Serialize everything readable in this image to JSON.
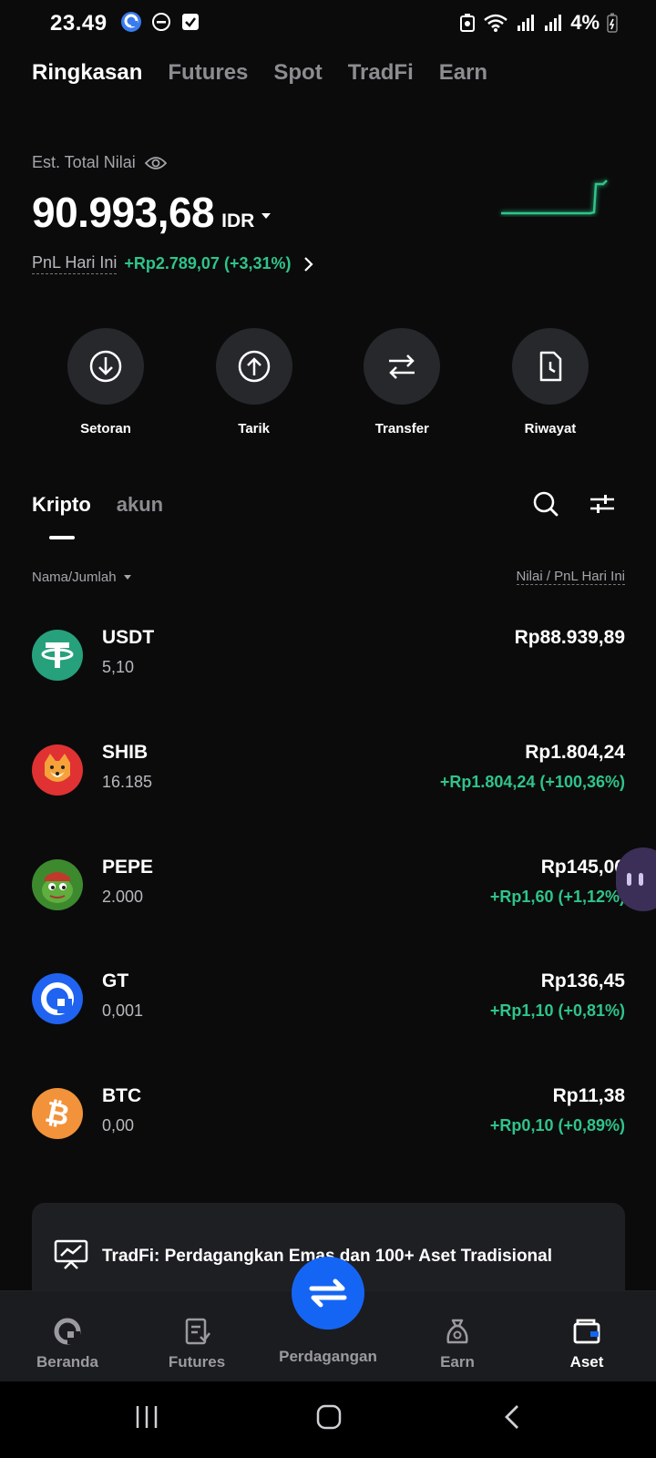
{
  "status_bar": {
    "time": "23.49",
    "battery": "4%"
  },
  "top_tabs": [
    "Ringkasan",
    "Futures",
    "Spot",
    "TradFi",
    "Earn"
  ],
  "summary": {
    "est_label": "Est. Total Nilai",
    "balance": "90.993,68",
    "currency": "IDR",
    "pnl_label": "PnL Hari Ini",
    "pnl_value": "+Rp2.789,07 (+3,31%)"
  },
  "actions": [
    {
      "label": "Setoran",
      "icon": "deposit-icon"
    },
    {
      "label": "Tarik",
      "icon": "withdraw-icon"
    },
    {
      "label": "Transfer",
      "icon": "transfer-icon"
    },
    {
      "label": "Riwayat",
      "icon": "history-icon"
    }
  ],
  "section_tabs": [
    "Kripto",
    "akun"
  ],
  "list_header": {
    "left": "Nama/Jumlah",
    "right": "Nilai / PnL Hari Ini"
  },
  "assets": [
    {
      "symbol": "USDT",
      "amount": "5,10",
      "value": "Rp88.939,89",
      "pnl": "",
      "color": "#26a17b"
    },
    {
      "symbol": "SHIB",
      "amount": "16.185",
      "value": "Rp1.804,24",
      "pnl": "+Rp1.804,24 (+100,36%)",
      "color": "#e03232"
    },
    {
      "symbol": "PEPE",
      "amount": "2.000",
      "value": "Rp145,06",
      "pnl": "+Rp1,60 (+1,12%)",
      "color": "#3d8a2e"
    },
    {
      "symbol": "GT",
      "amount": "0,001",
      "value": "Rp136,45",
      "pnl": "+Rp1,10 (+0,81%)",
      "color": "#1f63f0"
    },
    {
      "symbol": "BTC",
      "amount": "0,00",
      "value": "Rp11,38",
      "pnl": "+Rp0,10 (+0,89%)",
      "color": "#f2923a"
    }
  ],
  "tradfi_banner": "TradFi: Perdagangkan Emas dan 100+ Aset Tradisional",
  "bottom_nav": {
    "home": "Beranda",
    "futures": "Futures",
    "trade": "Perdagangan",
    "earn": "Earn",
    "assets": "Aset"
  },
  "colors": {
    "positive": "#2fc48a",
    "accent": "#1565f5",
    "background": "#0b0b0c"
  }
}
